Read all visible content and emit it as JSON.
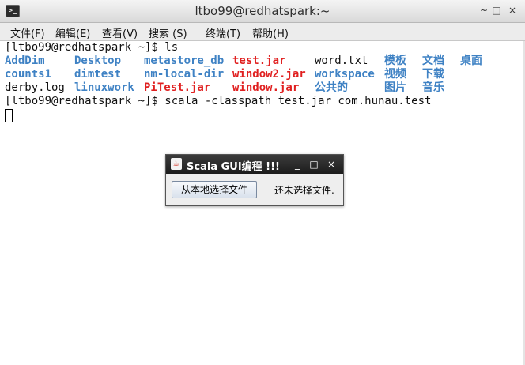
{
  "window": {
    "title": "ltbo99@redhatspark:~",
    "icon": "terminal-icon",
    "controls": {
      "minimize": "~",
      "maximize": "□",
      "close": "×"
    }
  },
  "menu": [
    {
      "label": "文件(F)"
    },
    {
      "label": "编辑(E)"
    },
    {
      "label": "查看(V)"
    },
    {
      "label": "搜索 (S)"
    },
    {
      "label": "终端(T)"
    },
    {
      "label": "帮助(H)"
    }
  ],
  "terminal": {
    "prompt1": "[ltbo99@redhatspark ~]$ ls",
    "ls_rows": [
      [
        "AddDim",
        "Desktop",
        "metastore_db",
        "test.jar",
        "word.txt",
        "模板",
        "文档",
        "桌面"
      ],
      [
        "counts1",
        "dimtest",
        "nm-local-dir",
        "window2.jar",
        "workspace",
        "视频",
        "下载"
      ],
      [
        "derby.log",
        "linuxwork",
        "PiTest.jar",
        "window.jar",
        "公共的",
        "图片",
        "音乐"
      ]
    ],
    "prompt2": "[ltbo99@redhatspark ~]$ scala -classpath test.jar com.hunau.test",
    "colors": {
      "directory": "#3f82c4",
      "archive": "#e02020",
      "plain": "#111111"
    }
  },
  "dialog": {
    "title": "Scala GUI编程 !!!",
    "controls": {
      "minimize": "_",
      "maximize": "□",
      "close": "×"
    },
    "button_label": "从本地选择文件",
    "status_text": "还未选择文件."
  }
}
